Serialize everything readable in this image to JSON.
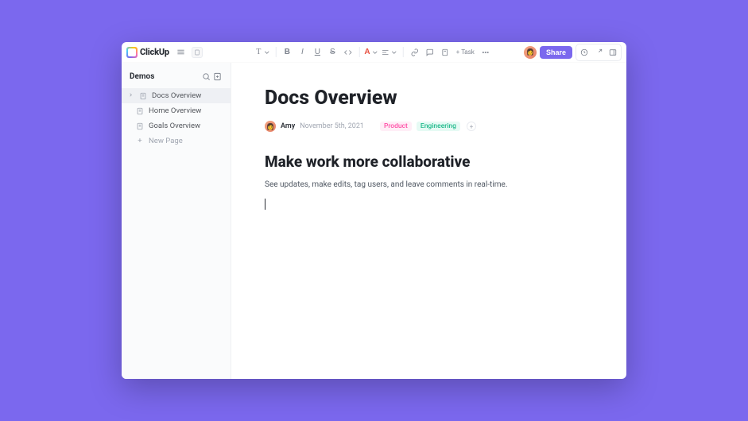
{
  "brand": {
    "name": "ClickUp"
  },
  "topbar": {
    "share_label": "Share",
    "task_label": "Task"
  },
  "sidebar": {
    "workspace": "Demos",
    "new_page_label": "New Page",
    "items": [
      {
        "label": "Docs Overview",
        "active": true,
        "expandable": true
      },
      {
        "label": "Home Overview",
        "active": false,
        "expandable": false
      },
      {
        "label": "Goals Overview",
        "active": false,
        "expandable": false
      }
    ]
  },
  "doc": {
    "title": "Docs Overview",
    "author": "Amy",
    "date": "November 5th, 2021",
    "tags": [
      {
        "label": "Product",
        "kind": "product"
      },
      {
        "label": "Engineering",
        "kind": "eng"
      }
    ],
    "heading": "Make work more collaborative",
    "body": "See updates, make edits, tag users, and leave comments in real-time."
  }
}
